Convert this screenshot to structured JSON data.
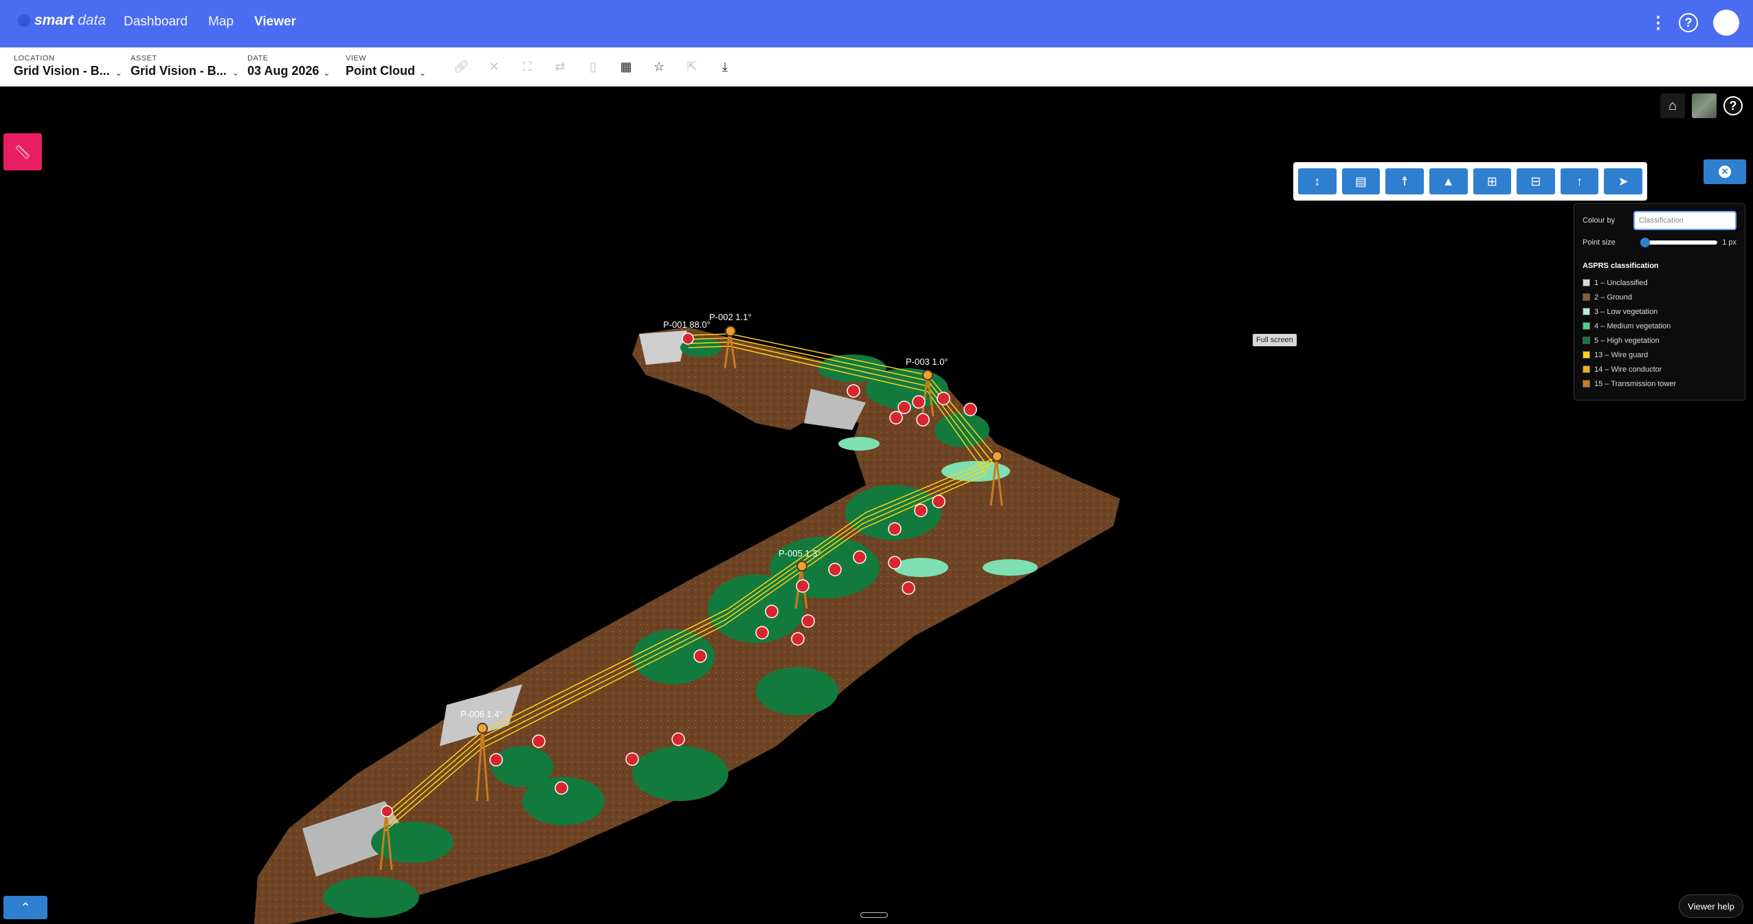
{
  "app": {
    "logo_bold": "smart",
    "logo_light": "data"
  },
  "nav": {
    "items": [
      "Dashboard",
      "Map",
      "Viewer"
    ]
  },
  "header": {
    "kebab": "⋮",
    "help": "?"
  },
  "selectors": {
    "location": {
      "label": "LOCATION",
      "value": "Grid Vision - B..."
    },
    "asset": {
      "label": "ASSET",
      "value": "Grid Vision - B..."
    },
    "date": {
      "label": "DATE",
      "value": "03 Aug 2026"
    },
    "view": {
      "label": "VIEW",
      "value": "Point Cloud"
    }
  },
  "toolbar_icons": [
    "link-icon",
    "close-icon",
    "fullscreen-icon",
    "swap-icon",
    "document-icon",
    "qr-code-icon",
    "star-icon",
    "export-icon",
    "download-icon"
  ],
  "measure_tools": [
    "height-icon",
    "clipboard-icon",
    "person-icon",
    "tree-icon",
    "add-box-icon",
    "remove-box-icon",
    "arrow-up-icon",
    "send-icon"
  ],
  "panel": {
    "colour_by_label": "Colour by",
    "colour_by_value": "Classification",
    "point_size_label": "Point size",
    "point_size_value": "1 px",
    "section_title": "ASPRS classification",
    "legend": [
      {
        "label": "1 – Unclassified",
        "color": "#d9d9d9"
      },
      {
        "label": "2 – Ground",
        "color": "#8b5a33"
      },
      {
        "label": "3 – Low vegetation",
        "color": "#b7f0d6"
      },
      {
        "label": "4 – Medium vegetation",
        "color": "#4fd18a"
      },
      {
        "label": "5 – High vegetation",
        "color": "#137a3d"
      },
      {
        "label": "13 – Wire guard",
        "color": "#ffd21a"
      },
      {
        "label": "14 – Wire conductor",
        "color": "#f2b01e"
      },
      {
        "label": "15 – Transmission tower",
        "color": "#c97d1f"
      }
    ]
  },
  "scene": {
    "tower_labels": [
      "P-001 88.0°",
      "P-002 1.1°",
      "P-003 1.0°",
      "P-005 1.3°",
      "P-006 1.4°"
    ]
  },
  "overlays": {
    "fullscreen_tip": "Full screen",
    "viewer_help": "Viewer help"
  },
  "colors": {
    "brand": "#4a6cf0",
    "action": "#2f7fd1",
    "badge": "#e91e63",
    "ground": "#7a4a28",
    "vegetation": "#137a3d",
    "wire": "#ffd21a",
    "marker": "#d8262e"
  }
}
